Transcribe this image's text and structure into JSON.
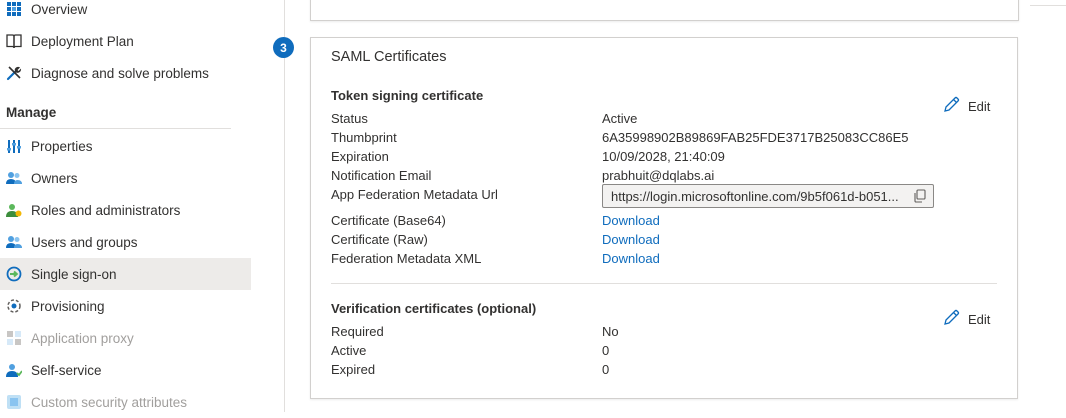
{
  "sidebar": {
    "items_top": [
      {
        "label": "Overview",
        "icon": "grid-icon"
      },
      {
        "label": "Deployment Plan",
        "icon": "book-icon"
      },
      {
        "label": "Diagnose and solve problems",
        "icon": "wrench-icon"
      }
    ],
    "section_label": "Manage",
    "items_manage": [
      {
        "label": "Properties",
        "icon": "properties-icon"
      },
      {
        "label": "Owners",
        "icon": "owners-icon"
      },
      {
        "label": "Roles and administrators",
        "icon": "roles-icon"
      },
      {
        "label": "Users and groups",
        "icon": "users-icon"
      },
      {
        "label": "Single sign-on",
        "icon": "sso-icon"
      },
      {
        "label": "Provisioning",
        "icon": "provisioning-icon"
      },
      {
        "label": "Application proxy",
        "icon": "app-proxy-icon"
      },
      {
        "label": "Self-service",
        "icon": "self-service-icon"
      },
      {
        "label": "Custom security attributes",
        "icon": "security-attributes-icon"
      }
    ],
    "selected": "Single sign-on"
  },
  "step": {
    "number": "3"
  },
  "card": {
    "title": "SAML Certificates",
    "token": {
      "title": "Token signing certificate",
      "edit_label": "Edit",
      "rows": {
        "status_label": "Status",
        "status_value": "Active",
        "thumbprint_label": "Thumbprint",
        "thumbprint_value": "6A35998902B89869FAB25FDE3717B25083CC86E5",
        "expiration_label": "Expiration",
        "expiration_value": "10/09/2028, 21:40:09",
        "email_label": "Notification Email",
        "email_value": "prabhuit@dqlabs.ai",
        "metadata_url_label": "App Federation Metadata Url",
        "metadata_url_value": "https://login.microsoftonline.com/9b5f061d-b051...",
        "cert_base64_label": "Certificate (Base64)",
        "cert_base64_link": "Download",
        "cert_raw_label": "Certificate (Raw)",
        "cert_raw_link": "Download",
        "fed_xml_label": "Federation Metadata XML",
        "fed_xml_link": "Download"
      }
    },
    "verification": {
      "title": "Verification certificates (optional)",
      "edit_label": "Edit",
      "rows": {
        "required_label": "Required",
        "required_value": "No",
        "active_label": "Active",
        "active_value": "0",
        "expired_label": "Expired",
        "expired_value": "0"
      }
    }
  },
  "colors": {
    "accent": "#0f6cbd",
    "selected_bg": "#edebe9",
    "border": "#d2d0ce"
  }
}
